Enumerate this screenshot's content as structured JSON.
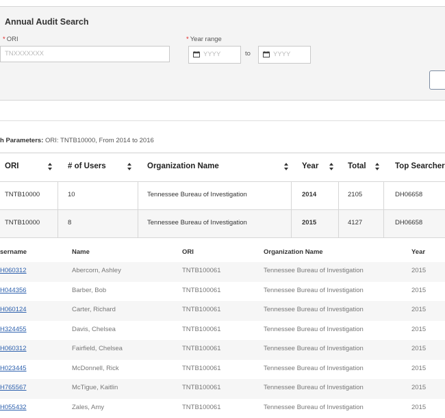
{
  "form": {
    "title": "Annual Audit Search",
    "required_marker": "*",
    "ori_label": "ORI",
    "ori_placeholder": "TNXXXXXXX",
    "year_label": "Year range",
    "year_from_placeholder": "YYYY",
    "to_label": "to",
    "year_to_placeholder": "YYYY"
  },
  "params": {
    "label": "h Parameters:",
    "value": " ORI: TNTB10000, From 2014 to 2016"
  },
  "summary": {
    "headers": {
      "ori": "ORI",
      "users": "# of Users",
      "org": "Organization Name",
      "year": "Year",
      "total": "Total",
      "top": "Top Searcher"
    },
    "rows": [
      {
        "ori": "TNTB10000",
        "users": "10",
        "org": "Tennessee Bureau of Investigation",
        "year": "2014",
        "total": "2105",
        "top": "DH06658"
      },
      {
        "ori": "TNTB10000",
        "users": "8",
        "org": "Tennessee Bureau of Investigation",
        "year": "2015",
        "total": "4127",
        "top": "DH06658"
      }
    ]
  },
  "details": {
    "headers": {
      "username": "sername",
      "name": "Name",
      "ori": "ORI",
      "org": "Organization Name",
      "year": "Year"
    },
    "rows": [
      {
        "username": "H060312",
        "name": "Abercorn, Ashley",
        "ori": "TNTB100061",
        "org": "Tennessee Bureau of Investigation",
        "year": "2015"
      },
      {
        "username": "H044356",
        "name": "Barber, Bob",
        "ori": "TNTB100061",
        "org": "Tennessee Bureau of Investigation",
        "year": "2015"
      },
      {
        "username": "H060124",
        "name": "Carter, Richard",
        "ori": "TNTB100061",
        "org": "Tennessee Bureau of Investigation",
        "year": "2015"
      },
      {
        "username": "H324455",
        "name": "Davis, Chelsea",
        "ori": "TNTB100061",
        "org": "Tennessee Bureau of Investigation",
        "year": "2015"
      },
      {
        "username": "H060312",
        "name": "Fairfield, Chelsea",
        "ori": "TNTB100061",
        "org": "Tennessee Bureau of Investigation",
        "year": "2015"
      },
      {
        "username": "H023445",
        "name": "McDonnell, Rick",
        "ori": "TNTB100061",
        "org": "Tennessee Bureau of Investigation",
        "year": "2015"
      },
      {
        "username": "H765567",
        "name": "McTigue, Kaitlin",
        "ori": "TNTB100061",
        "org": "Tennessee Bureau of Investigation",
        "year": "2015"
      },
      {
        "username": "H055432",
        "name": "Zales, Amy",
        "ori": "TNTB100061",
        "org": "Tennessee Bureau of Investigation",
        "year": "2015"
      }
    ]
  },
  "icons": {
    "calendar": "calendar-icon",
    "sort": "sort-icon"
  },
  "colors": {
    "panel_bg": "#f4f4f4",
    "link": "#2b5fad",
    "required": "#e02020",
    "alt_row": "#f6f6f6"
  }
}
